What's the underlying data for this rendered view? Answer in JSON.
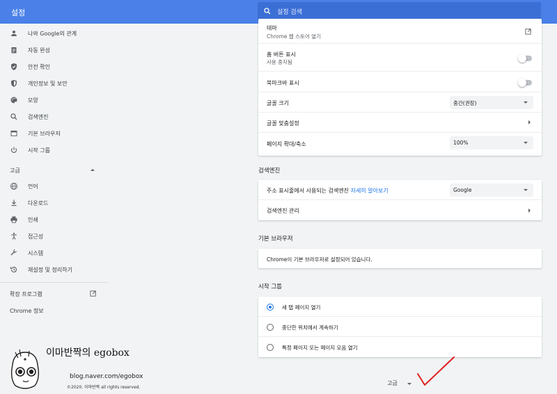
{
  "header": {
    "title": "설정",
    "search_placeholder": "설정 검색"
  },
  "sidebar": {
    "items": [
      {
        "label": "나와 Google의 관계",
        "icon": "person-icon"
      },
      {
        "label": "자동 완성",
        "icon": "clipboard-icon"
      },
      {
        "label": "안전 확인",
        "icon": "shield-check-icon"
      },
      {
        "label": "개인정보 및 보안",
        "icon": "shield-half-icon"
      },
      {
        "label": "모양",
        "icon": "palette-icon"
      },
      {
        "label": "검색엔진",
        "icon": "search-icon"
      },
      {
        "label": "기본 브라우저",
        "icon": "browser-icon"
      },
      {
        "label": "시작 그룹",
        "icon": "power-icon"
      }
    ],
    "advanced_label": "고급",
    "advanced_items": [
      {
        "label": "언어",
        "icon": "globe-icon"
      },
      {
        "label": "다운로드",
        "icon": "download-icon"
      },
      {
        "label": "인쇄",
        "icon": "printer-icon"
      },
      {
        "label": "접근성",
        "icon": "accessibility-icon"
      },
      {
        "label": "시스템",
        "icon": "wrench-icon"
      },
      {
        "label": "재설정 및 정리하기",
        "icon": "restore-icon"
      }
    ],
    "extensions_label": "확장 프로그램",
    "chrome_info_label": "Chrome 정보"
  },
  "appearance": {
    "theme_label": "테마",
    "theme_sub": "Chrome 웹 스토어 열기",
    "home_label": "홈 버튼 표시",
    "home_sub": "사용 중지됨",
    "bookmarks_label": "북마크바 표시",
    "font_size_label": "글꼴 크기",
    "font_size_value": "중간(권장)",
    "font_custom_label": "글꼴 맞춤설정",
    "zoom_label": "페이지 확대/축소",
    "zoom_value": "100%"
  },
  "search_engine": {
    "section_title": "검색엔진",
    "address_bar_label": "주소 표시줄에서 사용되는 검색엔진",
    "learn_more": "자세히 알아보기",
    "engine_value": "Google",
    "manage_label": "검색엔진 관리"
  },
  "default_browser": {
    "section_title": "기본 브라우저",
    "status": "Chrome이 기본 브라우저로 설정되어 있습니다."
  },
  "startup": {
    "section_title": "시작 그룹",
    "options": [
      {
        "label": "새 탭 페이지 열기",
        "selected": true
      },
      {
        "label": "중단한 위치에서 계속하기",
        "selected": false
      },
      {
        "label": "특정 페이지 또는 페이지 모음 열기",
        "selected": false
      }
    ]
  },
  "advanced_button": "고급",
  "watermark": {
    "title": "이마반짝의 egobox",
    "url": "blog.naver.com/egobox",
    "copyright": "©2020. 이마반짝 all rights reserved."
  },
  "colors": {
    "header": "#4a80e8",
    "accent": "#1a73e8",
    "annotation": "#e02020"
  }
}
